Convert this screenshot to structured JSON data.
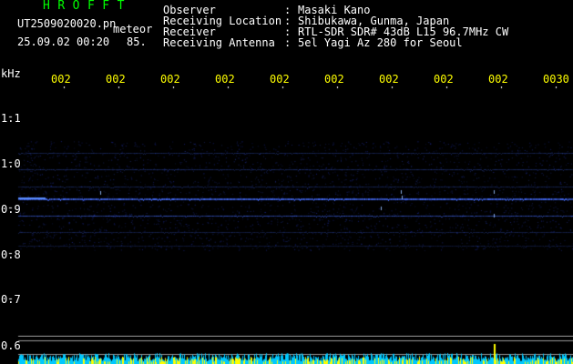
{
  "header": {
    "app_title": "HROFFT",
    "file_name": "UT2509020020.pn",
    "file_suffix": "meteor",
    "datetime": "25.09.02 00:20",
    "count": "85."
  },
  "station": [
    {
      "label": "Observer",
      "value": "Masaki Kano"
    },
    {
      "label": "Receiving Location",
      "value": "Shibukawa, Gunma, Japan"
    },
    {
      "label": "Receiver",
      "value": "RTL-SDR SDR# 43dB L15 96.7MHz CW"
    },
    {
      "label": "Receiving Antenna",
      "value": "5el Yagi Az 280 for Seoul"
    }
  ],
  "axis": {
    "freq_unit": "kHz",
    "freq_ticks": [
      "1.1",
      "1.0",
      "0.9",
      "0.8",
      "0.7",
      "0.6"
    ],
    "time_ticks": [
      "002",
      "002",
      "002",
      "002",
      "002",
      "002",
      "002",
      "002",
      "002",
      "0030"
    ]
  },
  "colors": {
    "title": "#00ff00",
    "text": "#ffffff",
    "time_ticks": "#ffff00",
    "background": "#000000",
    "signal": "#3a5cff",
    "noise_cyan": "#00c8ff",
    "noise_yellow": "#ffff00"
  }
}
